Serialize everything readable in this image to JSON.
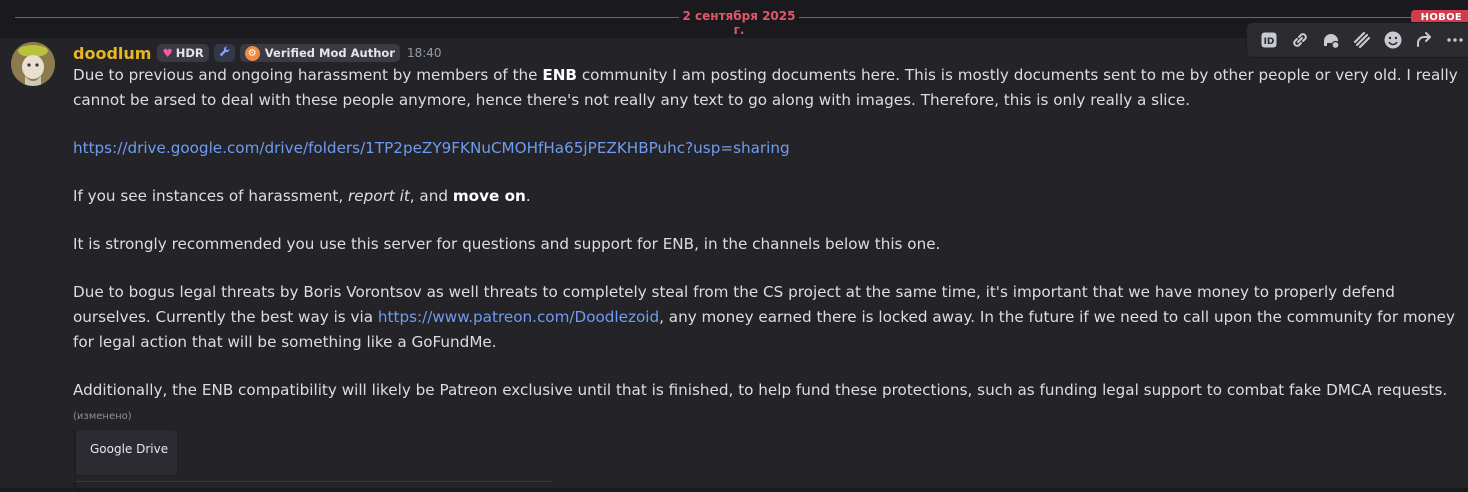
{
  "divider": {
    "date": "2 сентября 2025 г.",
    "new_label": "НОВОЕ"
  },
  "message": {
    "author": "doodlum",
    "tags": {
      "hdr": "HDR",
      "verified": "Verified Mod Author"
    },
    "time": "18:40",
    "p1": {
      "a": "Due to previous and ongoing harassment by members of the ",
      "b": "ENB",
      "c": " community I am posting documents here. This is mostly documents sent to me by other people or very old. I really cannot be arsed to deal with these people anymore, hence there's not really any text to go along with images. Therefore, this is only really a slice."
    },
    "link_drive": "https://drive.google.com/drive/folders/1TP2peZY9FKNuCMOHfHa65jPEZKHBPuhc?usp=sharing",
    "p3": {
      "a": "If you see instances of harassment, ",
      "b": "report it",
      "c": ", and ",
      "d": "move on",
      "e": "."
    },
    "p4": "It is strongly recommended you use this server for questions and support for ENB, in the channels below this one.",
    "p5": {
      "a": "Due to bogus legal threats by Boris Vorontsov as well threats to completely steal from the CS project at the same time, it's important that we have money to properly defend ourselves. Currently the best way is via ",
      "link": "https://www.patreon.com/Doodlezoid",
      "c": ", any money earned there is locked away. In the future if we need to call upon the community for money for legal action that will be something like a GoFundMe."
    },
    "p6": "Additionally, the ENB compatibility will likely be Patreon exclusive until that is finished, to help fund these protections, such as funding legal support to combat fake DMCA requests.",
    "edited": "(изменено)",
    "embed_title": "Google Drive"
  },
  "toolbar": {
    "icons": [
      "id-icon",
      "link-icon",
      "app-icon",
      "stripes-icon",
      "emoji-icon",
      "reply-icon",
      "more-icon"
    ]
  },
  "colors": {
    "username": "#e5b628",
    "link": "#6f9cf0",
    "divider": "#d13b4e",
    "background": "#242428"
  }
}
